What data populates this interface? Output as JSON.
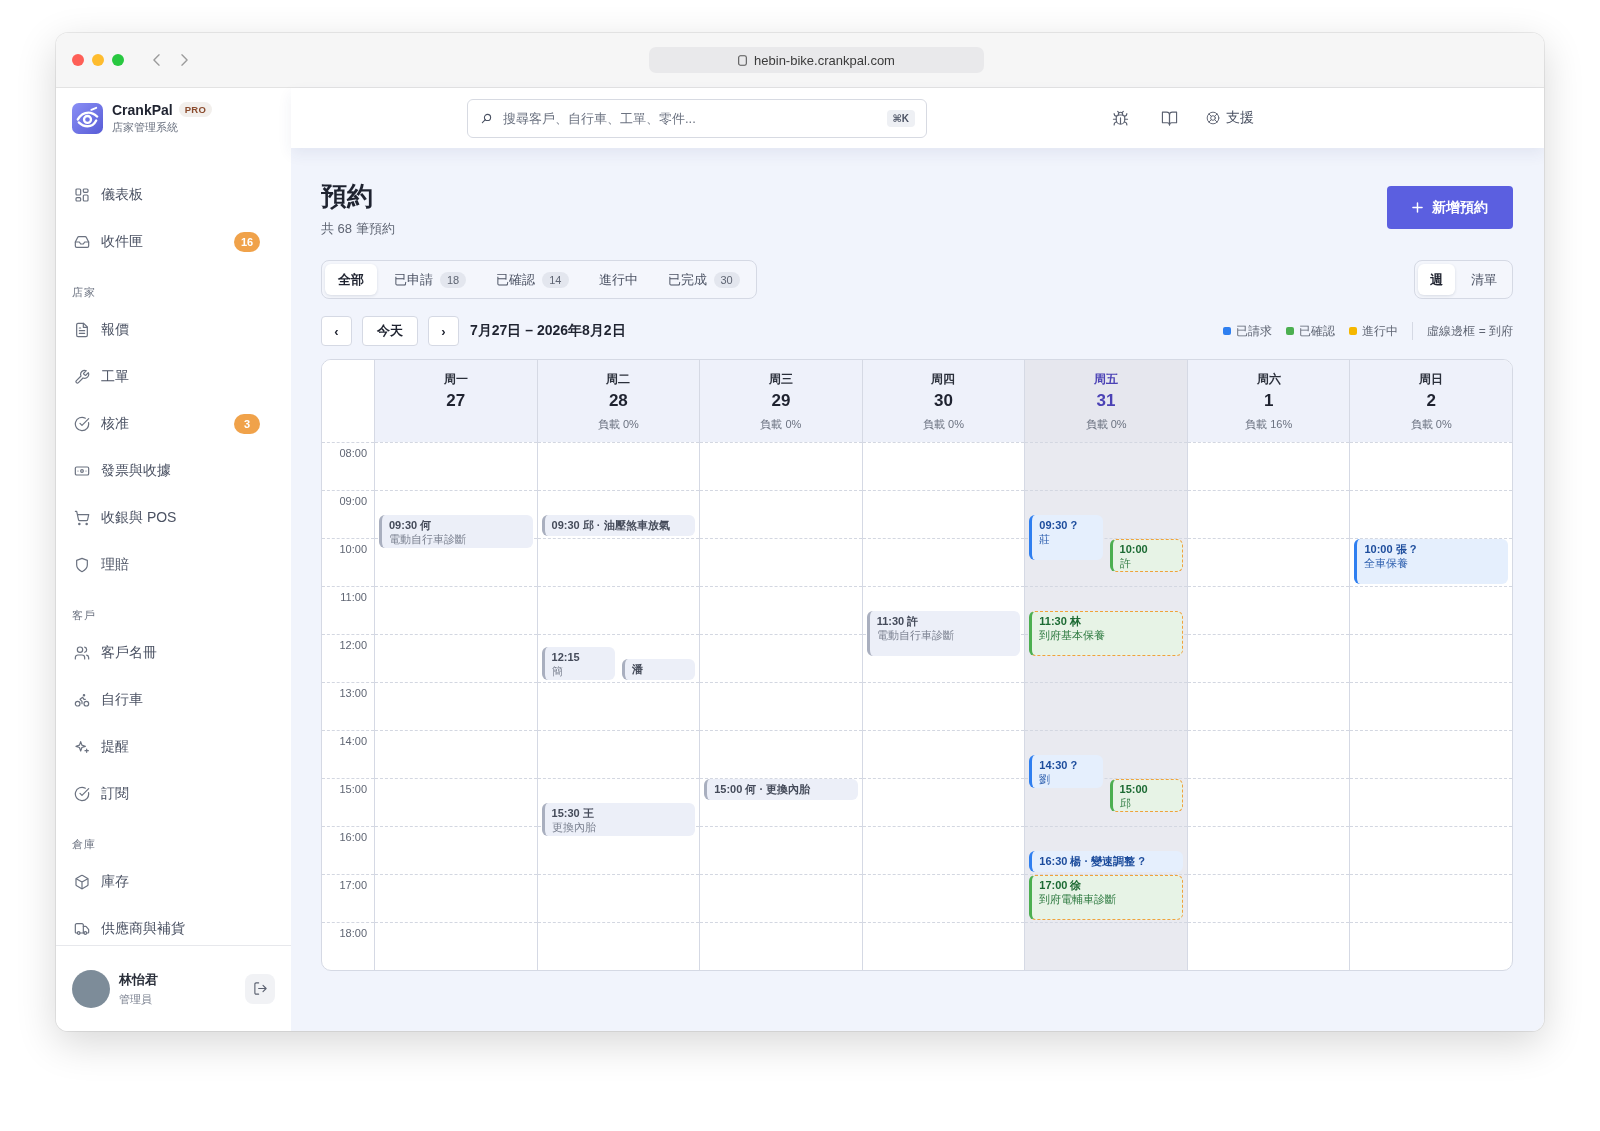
{
  "browser": {
    "url": "hebin-bike.crankpal.com"
  },
  "brand": {
    "name": "CrankPal",
    "badge": "PRO",
    "subtitle": "店家管理系統"
  },
  "sidebar": {
    "groups": [
      {
        "items": [
          {
            "label": "儀表板",
            "selected": false
          },
          {
            "label": "收件匣",
            "badge": "16",
            "selected": false
          }
        ]
      },
      {
        "title": "店家",
        "items": [
          {
            "label": "報價",
            "selected": false
          },
          {
            "label": "工單",
            "selected": false
          },
          {
            "label": "核准",
            "badge": "3",
            "selected": false
          },
          {
            "label": "發票與收據",
            "selected": false
          },
          {
            "label": "收銀與 POS",
            "selected": false
          },
          {
            "label": "理賠",
            "selected": false
          }
        ]
      },
      {
        "title": "客戶",
        "items": [
          {
            "label": "客戶名冊",
            "selected": false
          },
          {
            "label": "自行車",
            "selected": false
          },
          {
            "label": "提醒",
            "selected": false
          },
          {
            "label": "訂閱",
            "selected": false
          }
        ]
      },
      {
        "title": "倉庫",
        "items": [
          {
            "label": "庫存",
            "selected": false
          },
          {
            "label": "供應商與補貨",
            "selected": false
          }
        ]
      }
    ]
  },
  "user": {
    "name": "林怡君",
    "role": "管理員"
  },
  "topbar": {
    "search": {
      "placeholder": "搜尋客戶、自行車、工單、零件...",
      "shortcut": "⌘K"
    },
    "support": "支援"
  },
  "page": {
    "title": "預約",
    "subtitle": "共 68 筆預約",
    "new_button": "新增預約"
  },
  "filters": [
    {
      "label": "全部",
      "selected": true
    },
    {
      "label": "已申請",
      "count": "18",
      "selected": false
    },
    {
      "label": "已確認",
      "count": "14",
      "selected": false
    },
    {
      "label": "進行中",
      "selected": false
    },
    {
      "label": "已完成",
      "count": "30",
      "selected": false
    }
  ],
  "views": [
    {
      "label": "週",
      "selected": true
    },
    {
      "label": "清單",
      "selected": false
    }
  ],
  "week_nav": {
    "prev": "‹",
    "today": "今天",
    "next": "›",
    "range": "7月27日 – 2026年8月2日"
  },
  "legend": {
    "items": [
      {
        "label": "已請求",
        "color": "#2f7ff0"
      },
      {
        "label": "已確認",
        "color": "#4caf50"
      },
      {
        "label": "進行中",
        "color": "#f5b700"
      }
    ],
    "note": "虛線邊框 = 到府"
  },
  "calendar": {
    "hours": [
      "08:00",
      "09:00",
      "10:00",
      "11:00",
      "12:00",
      "13:00",
      "14:00",
      "15:00",
      "16:00",
      "17:00",
      "18:00"
    ],
    "days": [
      {
        "weekday": "周一",
        "date": "27",
        "today": false,
        "events": [
          {
            "title": "09:30 何",
            "detail": "電動自行車診斷",
            "kind": "past",
            "onsite": false
          }
        ]
      },
      {
        "weekday": "周二",
        "date": "28",
        "load": "負載 0%",
        "today": false,
        "events": [
          {
            "title": "09:30 邱 · 油壓煞車放氣",
            "kind": "past",
            "onsite": false
          },
          {
            "title": "12:15",
            "detail": "簡",
            "kind": "past",
            "onsite": false
          },
          {
            "title": "潘",
            "kind": "past",
            "onsite": false
          },
          {
            "title": "15:30 王",
            "detail": "更換內胎",
            "kind": "past",
            "onsite": false
          }
        ]
      },
      {
        "weekday": "周三",
        "date": "29",
        "load": "負載 0%",
        "today": false,
        "events": [
          {
            "title": "15:00 何 · 更換內胎",
            "kind": "past",
            "onsite": false
          }
        ]
      },
      {
        "weekday": "周四",
        "date": "30",
        "load": "負載 0%",
        "today": false,
        "events": [
          {
            "title": "11:30 許",
            "detail": "電動自行車診斷",
            "kind": "past",
            "onsite": false
          }
        ]
      },
      {
        "weekday": "周五",
        "date": "31",
        "load": "負載 0%",
        "today": true,
        "events": [
          {
            "title": "09:30 ?",
            "detail": "莊",
            "kind": "requested",
            "onsite": false
          },
          {
            "title": "10:00",
            "detail": "許",
            "kind": "confirmed",
            "onsite": true
          },
          {
            "title": "11:30 林",
            "detail": "到府基本保養",
            "kind": "confirmed",
            "onsite": true
          },
          {
            "title": "14:30 ?",
            "detail": "劉",
            "kind": "requested",
            "onsite": false
          },
          {
            "title": "15:00",
            "detail": "邱",
            "kind": "confirmed",
            "onsite": true
          },
          {
            "title": "16:30 楊 · 變速調整 ?",
            "kind": "requested",
            "onsite": false
          },
          {
            "title": "17:00 徐",
            "detail": "到府電輔車診斷",
            "kind": "confirmed",
            "onsite": true
          }
        ]
      },
      {
        "weekday": "周六",
        "date": "1",
        "load": "負載 16%",
        "today": false
      },
      {
        "weekday": "周日",
        "date": "2",
        "load": "負載 0%",
        "today": false,
        "events": [
          {
            "title": "10:00 張 ?",
            "detail": "全車保養",
            "kind": "requested",
            "onsite": false
          }
        ]
      }
    ]
  }
}
